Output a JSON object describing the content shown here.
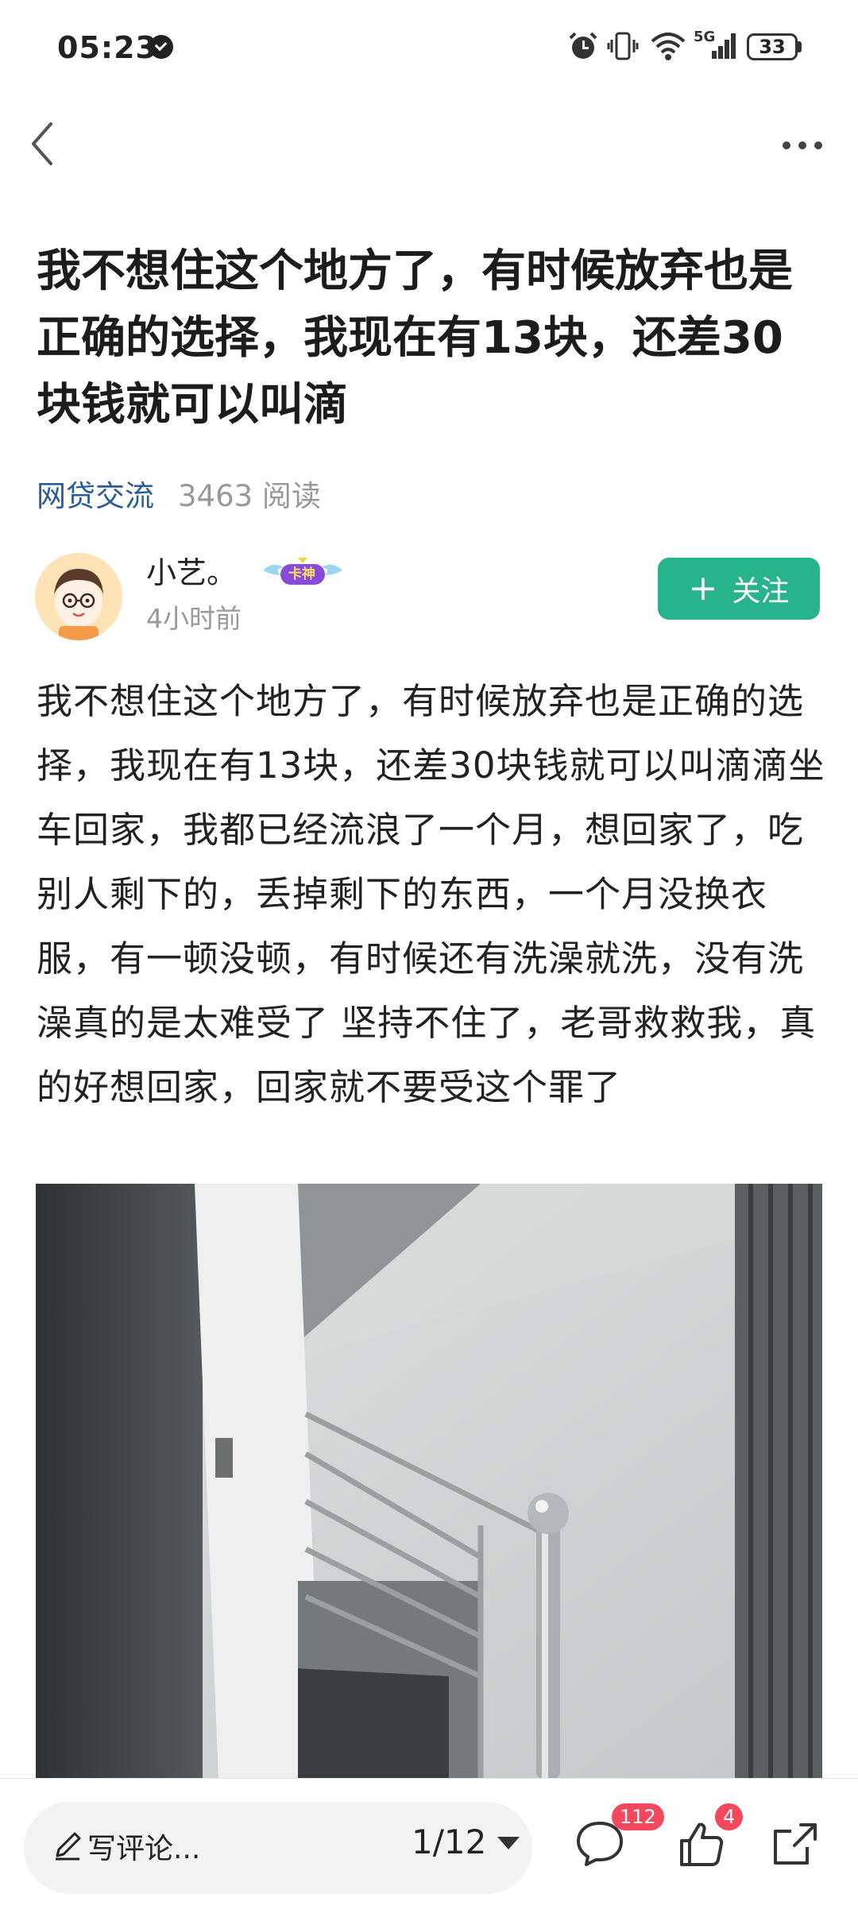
{
  "status_bar": {
    "time": "05:23",
    "network": "5G",
    "battery": "33",
    "icons": [
      "shield-check-icon",
      "alarm-icon",
      "vibrate-icon",
      "wifi-icon",
      "signal-icon",
      "battery-icon"
    ]
  },
  "nav": {
    "back_icon": "chevron-left-icon",
    "more_icon": "more-dots-icon"
  },
  "post": {
    "title": "我不想住这个地方了，有时候放弃也是正确的选择，我现在有13块，还差30块钱就可以叫滴",
    "tag": "网贷交流",
    "reads": "3463 阅读",
    "author": {
      "name": "小艺。",
      "badge_text": "卡神",
      "time": "4小时前"
    },
    "follow_label": "关注",
    "body": "我不想住这个地方了，有时候放弃也是正确的选择，我现在有13块，还差30块钱就可以叫滴滴坐车回家，我都已经流浪了一个月，想回家了，吃别人剩下的，丢掉剩下的东西，一个月没换衣服，有一顿没顿，有时候还有洗澡就洗，没有洗澡真的是太难受了 坚持不住了，老哥救救我，真的好想回家，回家就不要受这个罪了"
  },
  "bottom_bar": {
    "comment_placeholder": "写评论...",
    "pager": "1/12",
    "comment_count": "112",
    "like_count": "4"
  },
  "colors": {
    "accent_green": "#27b38b",
    "tag_blue": "#2a5c9a",
    "badge_red": "#f5475d"
  }
}
